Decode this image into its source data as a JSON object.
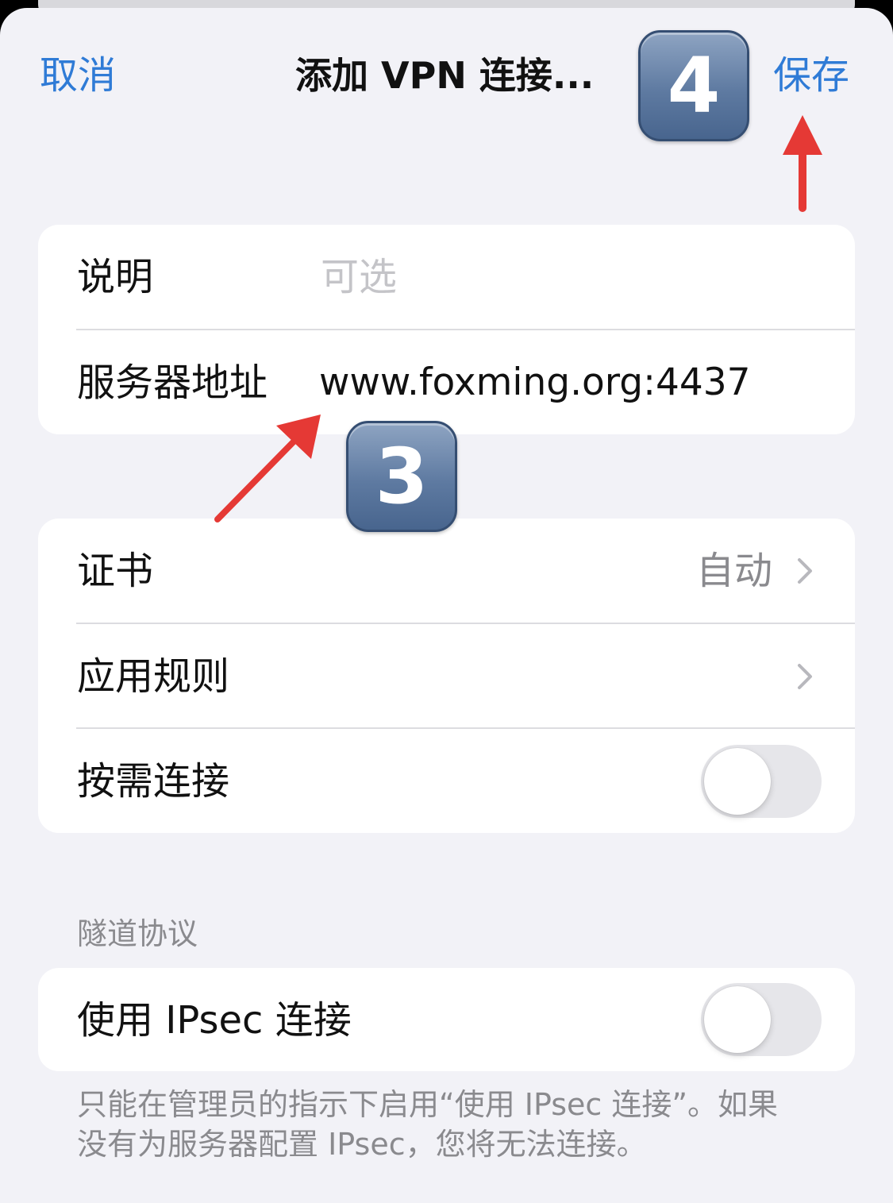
{
  "nav": {
    "cancel_label": "取消",
    "title": "添加 VPN 连接...",
    "save_label": "保存"
  },
  "annotations": {
    "step_3": "3",
    "step_4": "4",
    "arrow_color": "#e53935"
  },
  "basic_group": {
    "description": {
      "label": "说明",
      "placeholder": "可选",
      "value": ""
    },
    "server": {
      "label": "服务器地址",
      "value": "www.foxming.org:4437"
    }
  },
  "settings_group": {
    "certificate": {
      "label": "证书",
      "detail": "自动"
    },
    "app_rules": {
      "label": "应用规则"
    },
    "on_demand": {
      "label": "按需连接",
      "enabled": false
    }
  },
  "tunnel_section": {
    "header": "隧道协议",
    "ipsec": {
      "label": "使用 IPsec 连接",
      "enabled": false
    },
    "footnote_line1": "只能在管理员的指示下启用“使用 IPsec 连接”。如果",
    "footnote_line2": "没有为服务器配置 IPsec，您将无法连接。"
  },
  "colors": {
    "accent": "#2f7bd6",
    "background": "#f2f2f7",
    "card": "#ffffff",
    "secondary_text": "#8a8a8e",
    "toggle_off": "#e6e6ea"
  }
}
